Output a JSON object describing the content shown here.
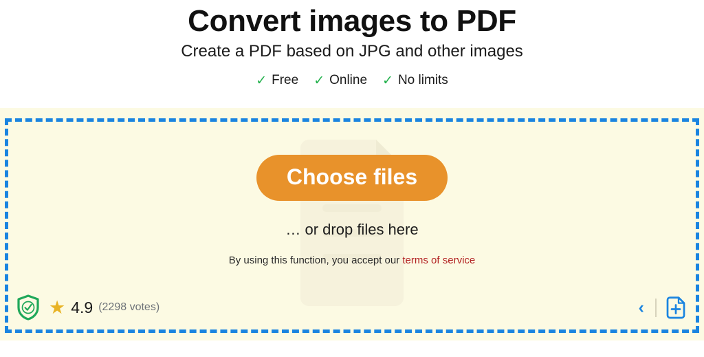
{
  "header": {
    "title": "Convert images to PDF",
    "subtitle": "Create a PDF based on JPG and other images",
    "features": [
      {
        "check": "✓",
        "label": "Free"
      },
      {
        "check": "✓",
        "label": "Online"
      },
      {
        "check": "✓",
        "label": "No limits"
      }
    ]
  },
  "dropzone": {
    "choose_files_label": "Choose files",
    "drop_hint": "… or drop files here",
    "terms_prefix": "By using this function, you accept our ",
    "terms_link": "terms of service"
  },
  "footer": {
    "shield_icon": "verified-shield-icon",
    "star_icon": "★",
    "rating_score": "4.9",
    "rating_votes": "(2298 votes)",
    "prev_chevron": "‹",
    "add_file_icon": "add-file-icon"
  },
  "colors": {
    "accent_orange": "#e8922b",
    "dashed_blue": "#1a84e0",
    "band_cream": "#fcfae3",
    "check_green": "#22b14c",
    "shield_green": "#1fa85a",
    "star_gold": "#e8b325",
    "link_red": "#b22222",
    "votes_gray": "#6d7278"
  }
}
